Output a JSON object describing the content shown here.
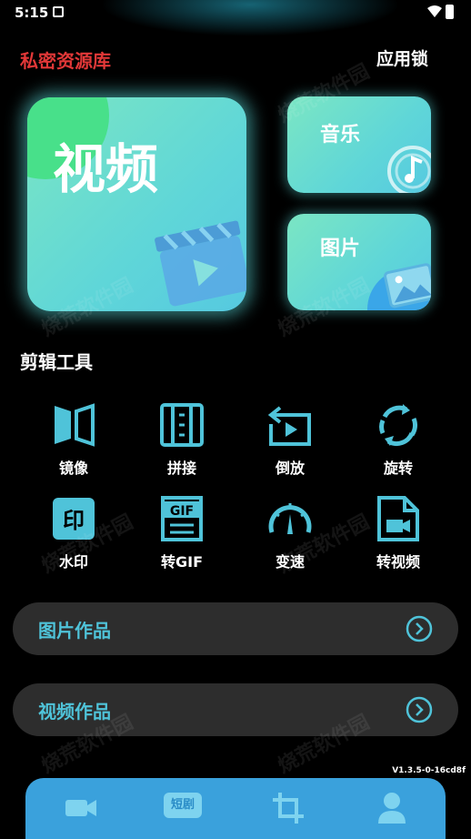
{
  "status_bar": {
    "time": "5:15"
  },
  "header": {
    "title": "私密资源库",
    "app_lock": "应用锁"
  },
  "cards": {
    "video": {
      "label": "视频"
    },
    "music": {
      "label": "音乐"
    },
    "image": {
      "label": "图片"
    }
  },
  "tools": {
    "section_title": "剪辑工具",
    "items": [
      {
        "label": "镜像",
        "icon": "mirror-icon"
      },
      {
        "label": "拼接",
        "icon": "splice-icon"
      },
      {
        "label": "倒放",
        "icon": "reverse-play-icon"
      },
      {
        "label": "旋转",
        "icon": "rotate-icon"
      },
      {
        "label": "水印",
        "icon": "watermark-icon"
      },
      {
        "label": "转GIF",
        "icon": "gif-icon"
      },
      {
        "label": "变速",
        "icon": "speedometer-icon"
      },
      {
        "label": "转视频",
        "icon": "video-file-icon"
      }
    ]
  },
  "works": {
    "image_works": "图片作品",
    "video_works": "视频作品"
  },
  "version": "V1.3.5-0-16cd8f",
  "watermark_text": "烧荒软件园",
  "bottom_nav": {
    "items": [
      {
        "icon": "video-camera-icon"
      },
      {
        "icon": "short-drama-icon",
        "label": "短剧"
      },
      {
        "icon": "crop-icon"
      },
      {
        "icon": "user-icon"
      }
    ]
  },
  "colors": {
    "accent": "#4fc3d9",
    "title_red": "#e23838",
    "nav_bg": "#3aa1dc",
    "card_bg": "#2d2d2d"
  }
}
